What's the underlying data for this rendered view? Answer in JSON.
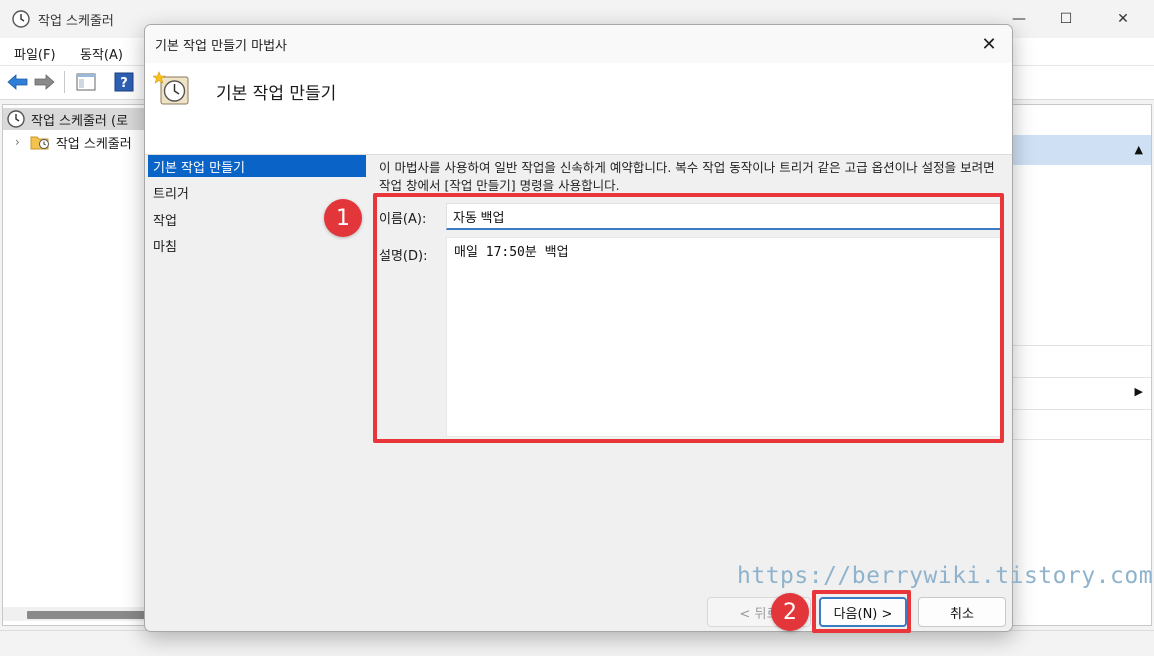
{
  "app": {
    "title": "작업 스케줄러",
    "menu": [
      "파일(F)",
      "동작(A)"
    ],
    "tree": {
      "root_label": "작업 스케줄러 (로",
      "child_label": "작업 스케줄러"
    },
    "window_controls": {
      "minimize": "—",
      "maximize": "☐",
      "close": "✕"
    }
  },
  "dialog": {
    "title": "기본 작업 만들기 마법사",
    "close_glyph": "✕",
    "header_title": "기본 작업 만들기",
    "steps": [
      "기본 작업 만들기",
      "트리거",
      "작업",
      "마침"
    ],
    "active_step_index": 0,
    "description": "이 마법사를 사용하여 일반 작업을 신속하게 예약합니다. 복수 작업 동작이나 트리거 같은 고급 옵션이나 설정을 보려면 작업 창에서 [작업 만들기] 명령을 사용합니다.",
    "name_label": "이름(A):",
    "name_value": "자동 백업",
    "desc_label": "설명(D):",
    "desc_value": "매일 17:50분 백업",
    "buttons": {
      "back": "< 뒤로",
      "next": "다음(N) >",
      "cancel": "취소"
    }
  },
  "annotations": {
    "badge_1": "1",
    "badge_2": "2",
    "watermark": "https://berrywiki.tistory.com",
    "highlight_color": "#e8363b"
  },
  "colors": {
    "selection": "#0a64c8",
    "actions_header": "#cfe0f5",
    "input_underline": "#3a7bc4"
  }
}
